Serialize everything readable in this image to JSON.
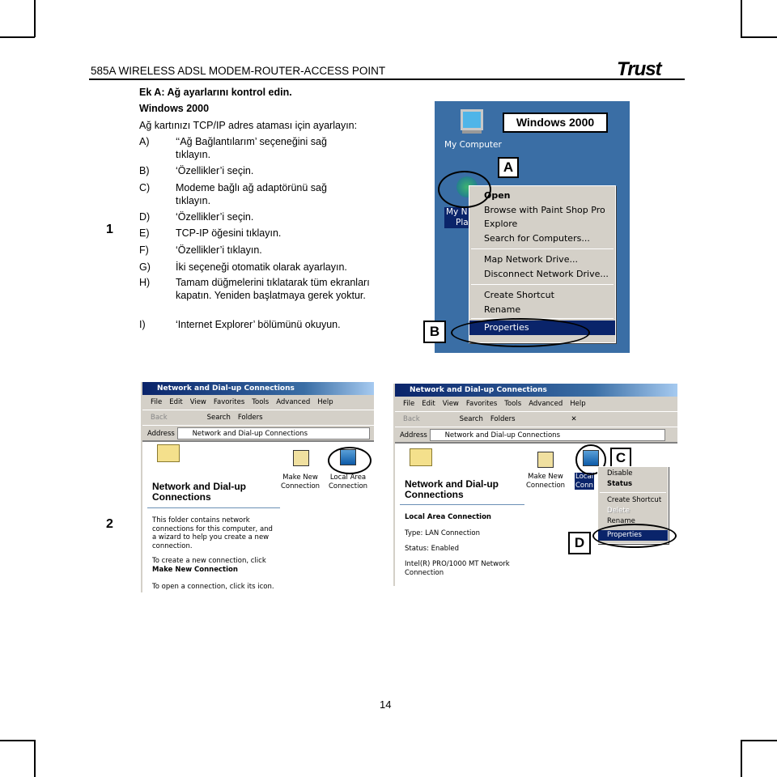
{
  "header": {
    "title": "585A WIRELESS ADSL MODEM-ROUTER-ACCESS POINT",
    "logo": "Trust"
  },
  "section1": {
    "number": "1",
    "heading": "Ek A: Ağ ayarlarını kontrol edin.",
    "os": "Windows 2000",
    "intro": "Ağ kartınızı TCP/IP adres ataması için ayarlayın:",
    "steps": [
      {
        "label": "A)",
        "text": "‘‘Ağ Bağlantılarım’ seçeneğini sağ tıklayın."
      },
      {
        "label": "B)",
        "text": "‘Özellikler’i seçin."
      },
      {
        "label": "C)",
        "text": "Modeme bağlı ağ adaptörünü sağ tıklayın."
      },
      {
        "label": "D)",
        "text": "‘Özellikler’i seçin."
      },
      {
        "label": "E)",
        "text": "TCP-IP öğesini tıklayın."
      },
      {
        "label": "F)",
        "text": "‘Özellikler’i tıklayın."
      },
      {
        "label": "G)",
        "text": "İki seçeneği otomatik olarak ayarlayın."
      },
      {
        "label": "H)",
        "text": "Tamam düğmelerini tıklatarak tüm ekranları kapatın. Yeniden başlatmaya gerek yoktur."
      },
      {
        "label": "I)",
        "text": "‘Internet Explorer’ bölümünü okuyun."
      }
    ]
  },
  "screenshot1": {
    "badge": "Windows 2000",
    "callout_a": "A",
    "callout_b": "B",
    "desktop_icons": [
      "My Computer",
      "My N",
      "Pla"
    ],
    "menu": [
      "Open",
      "Browse with Paint Shop Pro",
      "Explore",
      "Search for Computers...",
      "Map Network Drive...",
      "Disconnect Network Drive...",
      "Create Shortcut",
      "Rename",
      "Properties"
    ],
    "desktop_color": "#3a6ea5"
  },
  "section2": {
    "number": "2"
  },
  "window": {
    "title": "Network and Dial-up Connections",
    "menu1": [
      "File",
      "Edit",
      "View",
      "Favorites",
      "Tools",
      "Advanced",
      "Help"
    ],
    "toolbar": [
      "Back",
      "Search",
      "Folders"
    ],
    "address_label": "Address",
    "address_value": "Network and Dial-up Connections",
    "heading": "Network and Dial-up Connections",
    "icon_make_new": "Make New Connection",
    "icon_lan": "Local Area Connection",
    "left": {
      "p1": "This folder contains network connections for this computer, and a wizard to help you create a new connection.",
      "p2a": "To create a new connection, click",
      "p2b": "Make New Connection",
      "p3": "To open a connection, click its icon."
    }
  },
  "window2": {
    "lan_short1": "Local",
    "lan_short2": "Conn",
    "info_title": "Local Area Connection",
    "type": "Type: LAN Connection",
    "status": "Status: Enabled",
    "device": "Intel(R) PRO/1000 MT Network Connection",
    "callout_c": "C",
    "callout_d": "D",
    "menu": [
      "Disable",
      "Status",
      "Create Shortcut",
      "Delete",
      "Rename",
      "Properties"
    ]
  },
  "footer": {
    "page": "14"
  }
}
